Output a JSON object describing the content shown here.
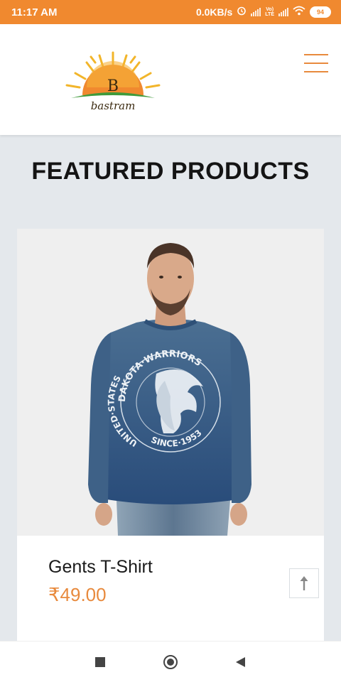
{
  "status_bar": {
    "time": "11:17 AM",
    "speed": "0.0KB/s",
    "volte_top": "Vo)",
    "volte_bottom": "LTE",
    "battery": "94"
  },
  "header": {
    "logo_text": "bastram",
    "logo_letter": "B"
  },
  "section": {
    "title": "FEATURED PRODUCTS"
  },
  "product": {
    "name": "Gents T-Shirt",
    "price": "₹49.00",
    "print_top": "DAKOTA·WARRIORS",
    "print_left": "UNITED·STATES",
    "print_bottom": "SINCE·1953"
  },
  "colors": {
    "accent": "#f0892f",
    "price": "#e88a3d",
    "background": "#e4e8ec"
  }
}
